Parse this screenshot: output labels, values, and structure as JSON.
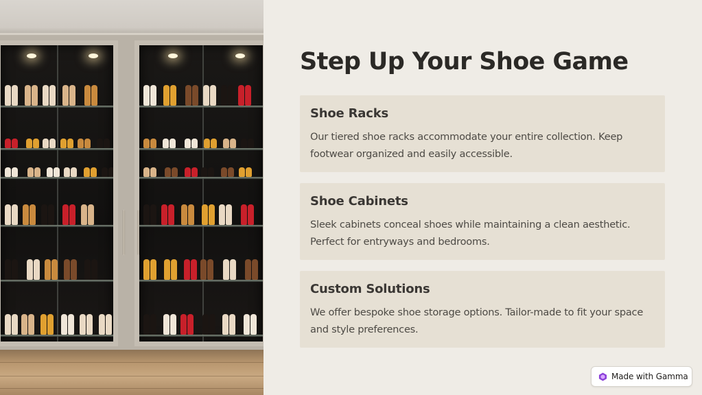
{
  "slide": {
    "title": "Step Up Your Shoe Game",
    "image": {
      "subject": "glass-door shoe cabinet"
    }
  },
  "cards": [
    {
      "title": "Shoe Racks",
      "body": "Our tiered shoe racks accommodate your entire collection. Keep footwear organized and easily accessible."
    },
    {
      "title": "Shoe Cabinets",
      "body": "Sleek cabinets conceal shoes while maintaining a clean aesthetic. Perfect for entryways and bedrooms."
    },
    {
      "title": "Custom Solutions",
      "body": "We offer bespoke shoe storage options. Tailor-made to fit your space and style preferences."
    }
  ],
  "badge": {
    "label": "Made with Gamma",
    "icon": "gamma-logo-icon"
  },
  "colors": {
    "background": "#efece6",
    "card": "#e6e0d4",
    "title": "#2b2926",
    "body_text": "#4d4a45",
    "badge_accent": "#8b3fd9"
  }
}
